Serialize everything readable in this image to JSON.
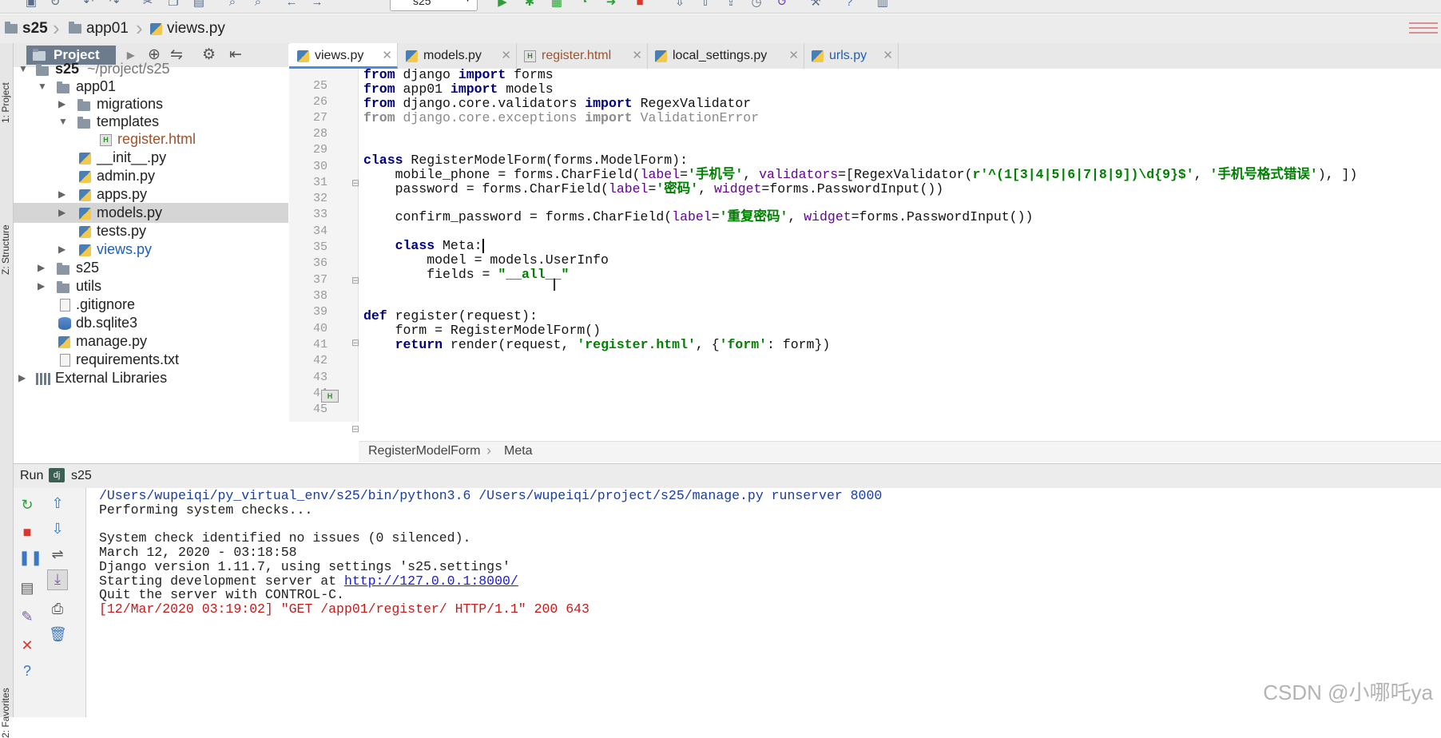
{
  "toolbar": {
    "run_config": "s25",
    "icons": [
      "save-icon",
      "sync-icon",
      "undo-icon",
      "cut-icon",
      "copy-icon",
      "paste-icon",
      "find-icon",
      "replace-icon",
      "back-icon",
      "forward-icon",
      "run-icon",
      "debug-icon",
      "coverage-icon",
      "profile-icon",
      "concurrency-icon",
      "stop-icon",
      "vcs-update-icon",
      "vcs-commit-icon",
      "vcs-push-icon",
      "vcs-history-icon",
      "vcs-revert-icon",
      "settings-icon",
      "help-icon",
      "sdk-icon"
    ]
  },
  "breadcrumb": [
    "s25",
    "app01",
    "views.py"
  ],
  "left_strip": {
    "project": "1: Project",
    "structure": "Z: Structure",
    "favorites": "2: Favorites"
  },
  "project_panel": {
    "tab_label": "Project",
    "tree": [
      {
        "label": "s25",
        "suffix": "~/project/s25",
        "type": "folder",
        "depth": 0,
        "expanded": true
      },
      {
        "label": "app01",
        "type": "folder",
        "depth": 1,
        "expanded": true
      },
      {
        "label": "migrations",
        "type": "folder",
        "depth": 2,
        "expanded": false
      },
      {
        "label": "templates",
        "type": "folder",
        "depth": 2,
        "expanded": true
      },
      {
        "label": "register.html",
        "type": "html",
        "depth": 3
      },
      {
        "label": "__init__.py",
        "type": "py",
        "depth": 2
      },
      {
        "label": "admin.py",
        "type": "py",
        "depth": 2
      },
      {
        "label": "apps.py",
        "type": "py",
        "depth": 2,
        "expandable": true
      },
      {
        "label": "models.py",
        "type": "py",
        "depth": 2,
        "expandable": true,
        "selected": true
      },
      {
        "label": "tests.py",
        "type": "py",
        "depth": 2
      },
      {
        "label": "views.py",
        "type": "py",
        "depth": 2,
        "expandable": true
      },
      {
        "label": "s25",
        "type": "folder",
        "depth": 1,
        "expanded": false
      },
      {
        "label": "utils",
        "type": "folder",
        "depth": 1,
        "expanded": false
      },
      {
        "label": ".gitignore",
        "type": "file",
        "depth": 1
      },
      {
        "label": "db.sqlite3",
        "type": "db",
        "depth": 1
      },
      {
        "label": "manage.py",
        "type": "py",
        "depth": 1
      },
      {
        "label": "requirements.txt",
        "type": "file",
        "depth": 1
      },
      {
        "label": "External Libraries",
        "type": "lib",
        "depth": 0,
        "expanded": false
      }
    ]
  },
  "editor": {
    "tabs": [
      {
        "label": "views.py",
        "type": "py",
        "active": true
      },
      {
        "label": "models.py",
        "type": "py"
      },
      {
        "label": "register.html",
        "type": "html"
      },
      {
        "label": "local_settings.py",
        "type": "py"
      },
      {
        "label": "urls.py",
        "type": "py"
      }
    ],
    "line_numbers": [
      "25",
      "26",
      "27",
      "28",
      "29",
      "30",
      "31",
      "32",
      "33",
      "34",
      "35",
      "36",
      "37",
      "38",
      "39",
      "40",
      "41",
      "42",
      "43",
      "44",
      "45"
    ],
    "code": {
      "l25": [
        "from",
        " django ",
        "import",
        " forms"
      ],
      "l26": [
        "from",
        " app01 ",
        "import",
        " models"
      ],
      "l27": [
        "from",
        " django.core.validators ",
        "import",
        " RegexValidator"
      ],
      "l28": [
        "from",
        " django.core.exceptions ",
        "import",
        " ValidationError"
      ],
      "l31": [
        "class",
        " RegisterModelForm(forms.ModelForm):"
      ],
      "l32": [
        "    mobile_phone = forms.CharField(",
        "label",
        "=",
        "'手机号'",
        ", ",
        "validators",
        "=[RegexValidator(",
        "r'^(1[3|4|5|6|7|8|9])\\d{9}$'",
        ", ",
        "'手机号格式错误'",
        "), ])"
      ],
      "l33": [
        "    password = forms.CharField(",
        "label",
        "=",
        "'密码'",
        ", ",
        "widget",
        "=forms.PasswordInput())"
      ],
      "l35": [
        "    confirm_password = forms.CharField(",
        "label",
        "=",
        "'重复密码'",
        ", ",
        "widget",
        "=forms.PasswordInput())"
      ],
      "l37": [
        "    ",
        "class",
        " Meta:"
      ],
      "l38": [
        "        model = models.UserInfo"
      ],
      "l39": [
        "        fields = ",
        "\"__all__\""
      ],
      "l42": [
        "def",
        " register(request):"
      ],
      "l43": [
        "    form = RegisterModelForm()"
      ],
      "l44": [
        "    ",
        "return",
        " render(request, ",
        "'register.html'",
        ", {",
        "'form'",
        ": form})"
      ]
    },
    "structure_crumbs": [
      "RegisterModelForm",
      "Meta"
    ]
  },
  "run_panel": {
    "title": "Run",
    "config": "s25",
    "console": [
      "/Users/wupeiqi/py_virtual_env/s25/bin/python3.6 /Users/wupeiqi/project/s25/manage.py runserver 8000",
      "Performing system checks...",
      "",
      "System check identified no issues (0 silenced).",
      "March 12, 2020 - 03:18:58",
      "Django version 1.11.7, using settings 's25.settings'",
      "Starting development server at ",
      "Quit the server with CONTROL-C.",
      "[12/Mar/2020 03:19:02] \"GET /app01/register/ HTTP/1.1\" 200 643"
    ],
    "server_link": "http://127.0.0.1:8000/"
  },
  "watermark": "CSDN @小哪吒ya"
}
